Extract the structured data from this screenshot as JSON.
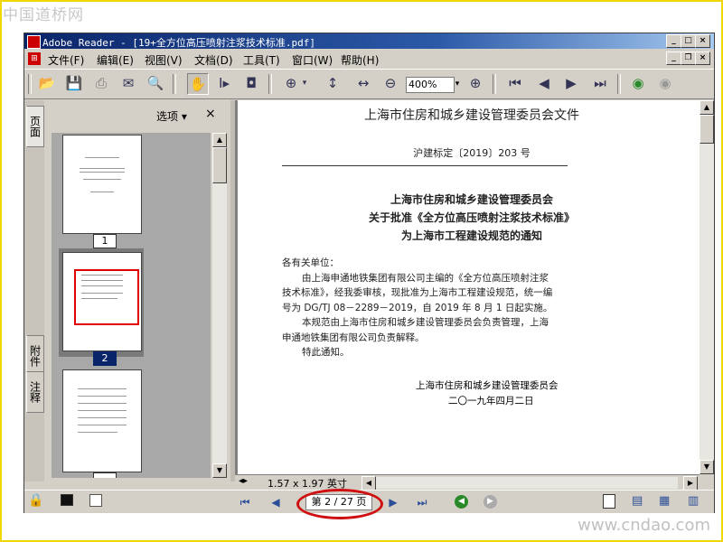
{
  "watermark": {
    "top_left": "中国道桥网",
    "bottom_right": "www.cndao.com"
  },
  "window": {
    "app": "Adobe Reader",
    "title": "Adobe Reader - [19+全方位高压喷射注浆技术标准.pdf]",
    "controls": [
      "_",
      "□",
      "×"
    ]
  },
  "menu": [
    "文件(F)",
    "编辑(E)",
    "视图(V)",
    "文档(D)",
    "工具(T)",
    "窗口(W)",
    "帮助(H)"
  ],
  "toolbar": {
    "zoom_value": "400%",
    "icons": [
      "open-icon",
      "save-icon",
      "print-icon",
      "email-icon",
      "search-icon",
      "hand-tool-icon",
      "select-text-icon",
      "snapshot-icon",
      "zoom-in-icon",
      "fit-width-icon",
      "fit-page-icon",
      "zoom-out-icon",
      "zoom-plus-icon",
      "first-page-icon",
      "prev-page-icon",
      "next-page-icon",
      "last-page-icon",
      "go-back-icon",
      "go-forward-icon"
    ]
  },
  "side_tabs": [
    "页面",
    "附件",
    "注释"
  ],
  "panel": {
    "options_label": "选项 ▾",
    "close": "×",
    "pages": [
      {
        "label": "1",
        "selected": false
      },
      {
        "label": "2",
        "selected": true
      },
      {
        "label": "",
        "selected": false
      }
    ]
  },
  "document": {
    "header": "上海市住房和城乡建设管理委员会文件",
    "doc_number": "沪建标定〔2019〕203 号",
    "title_lines": [
      "上海市住房和城乡建设管理委员会",
      "关于批准《全方位高压喷射注浆技术标准》",
      "为上海市工程建设规范的通知"
    ],
    "salutation": "各有关单位：",
    "body": [
      "由上海申通地铁集团有限公司主编的《全方位高压喷射注浆",
      "技术标准》，经我委审核，现批准为上海市工程建设规范，统一编",
      "号为 DG/TJ 08－2289－2019，自 2019 年 8 月 1 日起实施。",
      "本规范由上海市住房和城乡建设管理委员会负责管理，上海",
      "申通地铁集团有限公司负责解释。",
      "特此通知。"
    ],
    "signature": "上海市住房和城乡建设管理委员会",
    "date": "二〇一九年四月二日"
  },
  "page_size": "1.57 x 1.97 英寸",
  "status": {
    "page_indicator": "第 2 / 27 页",
    "current_page": 2,
    "total_pages": 27
  }
}
